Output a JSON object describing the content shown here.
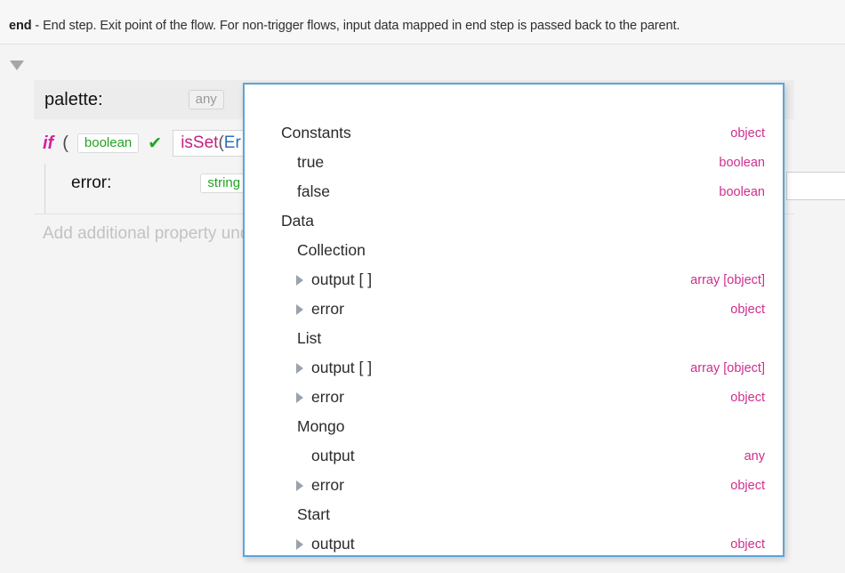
{
  "header": {
    "keyword": "end",
    "description": " - End step. Exit point of the flow. For non-trigger flows, input data mapped in end step is passed back to the parent."
  },
  "editor": {
    "collapse_icon": "triangle-down-icon",
    "palette": {
      "label": "palette:",
      "type": "any"
    },
    "if_statement": {
      "keyword": "if",
      "open_paren": "(",
      "type": "boolean",
      "valid_icon": "check-icon",
      "expression_fn": "isSet",
      "expression_paren": "(",
      "expression_ident": "Er"
    },
    "error_property": {
      "label": "error:",
      "type": "string",
      "caret_icon": "chevron-down-icon"
    },
    "add_property_placeholder": "Add additional property und"
  },
  "suggestions": {
    "items": [
      {
        "label": "Constants",
        "type": "object",
        "level": 0,
        "arrow": false
      },
      {
        "label": "true",
        "type": "boolean",
        "level": 1,
        "arrow": false
      },
      {
        "label": "false",
        "type": "boolean",
        "level": 1,
        "arrow": false
      },
      {
        "label": "Data",
        "type": "",
        "level": 0,
        "arrow": false
      },
      {
        "label": "Collection",
        "type": "",
        "level": 1,
        "arrow": false
      },
      {
        "label": "output [ ]",
        "type": "array [object]",
        "level": 2,
        "arrow": true
      },
      {
        "label": "error",
        "type": "object",
        "level": 2,
        "arrow": true
      },
      {
        "label": "List",
        "type": "",
        "level": 1,
        "arrow": false
      },
      {
        "label": "output [ ]",
        "type": "array [object]",
        "level": 2,
        "arrow": true
      },
      {
        "label": "error",
        "type": "object",
        "level": 2,
        "arrow": true
      },
      {
        "label": "Mongo",
        "type": "",
        "level": 1,
        "arrow": false
      },
      {
        "label": "output",
        "type": "any",
        "level": 2,
        "arrow": false
      },
      {
        "label": "error",
        "type": "object",
        "level": 2,
        "arrow": true
      },
      {
        "label": "Start",
        "type": "",
        "level": 1,
        "arrow": false
      },
      {
        "label": "output",
        "type": "object",
        "level": 2,
        "arrow": true
      }
    ]
  },
  "colors": {
    "type_label": "#cd2f8e",
    "panel_border": "#5aa5da",
    "keyword": "#d6219c",
    "valid": "#21a521",
    "chip_green": "#22a322"
  }
}
